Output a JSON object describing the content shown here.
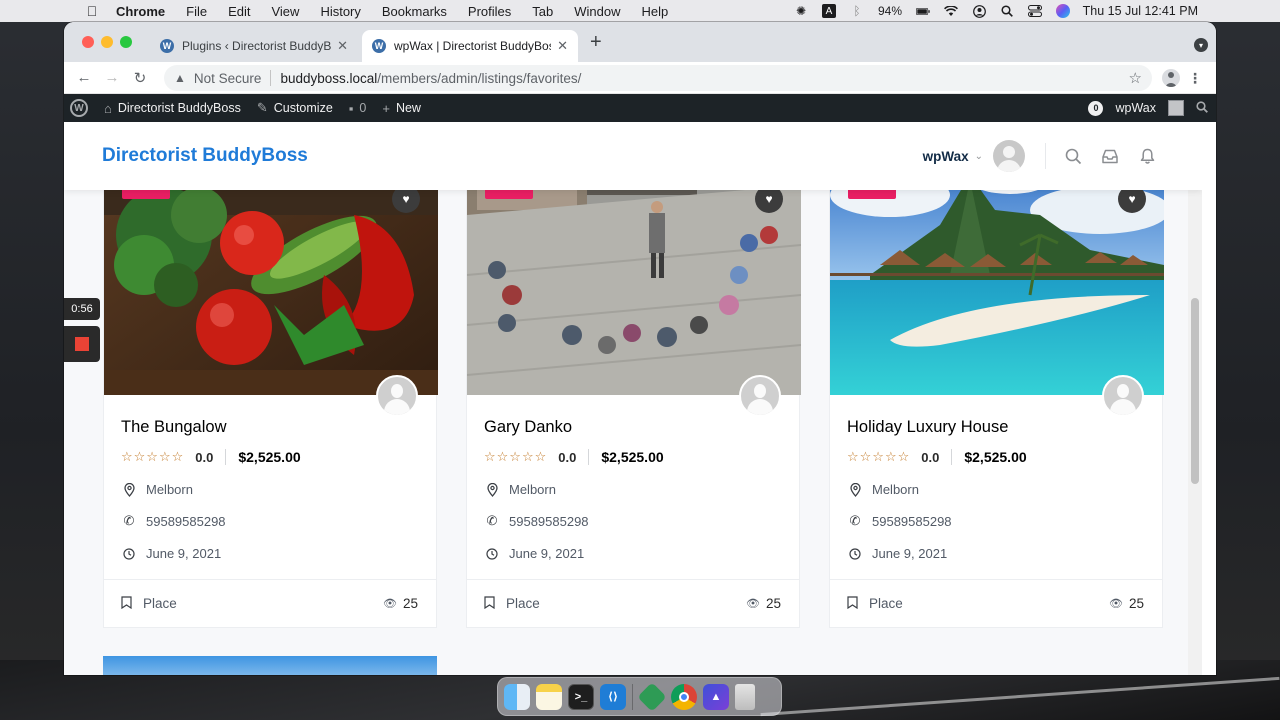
{
  "menubar": {
    "app_name": "Chrome",
    "items": [
      "File",
      "Edit",
      "View",
      "History",
      "Bookmarks",
      "Profiles",
      "Tab",
      "Window",
      "Help"
    ],
    "battery": "94%",
    "input_letter": "A",
    "clock": "Thu 15 Jul  12:41 PM"
  },
  "browser": {
    "tabs": [
      {
        "title": "Plugins ‹ Directorist BuddyBoss",
        "icon": "wordpress-icon"
      },
      {
        "title": "wpWax | Directorist BuddyBoss",
        "icon": "wordpress-icon"
      }
    ],
    "address": {
      "security": "Not Secure",
      "host": "buddyboss.local",
      "path": "/members/admin/listings/favorites/"
    }
  },
  "adminbar": {
    "site": "Directorist BuddyBoss",
    "customize": "Customize",
    "comments_count": "0",
    "new": "New",
    "notif_count": "0",
    "user": "wpWax"
  },
  "site": {
    "title": "Directorist BuddyBoss",
    "user_name": "wpWax",
    "accent": "#1f7bd8"
  },
  "recorder": {
    "timer": "0:56"
  },
  "listings": [
    {
      "title": "The Bungalow",
      "rating": "0.0",
      "price": "$2,525.00",
      "location": "Melborn",
      "phone": "59589585298",
      "date": "June 9, 2021",
      "category": "Place",
      "views": "25",
      "image": "vegetables"
    },
    {
      "title": "Gary Danko",
      "rating": "0.0",
      "price": "$2,525.00",
      "location": "Melborn",
      "phone": "59589585298",
      "date": "June 9, 2021",
      "category": "Place",
      "views": "25",
      "image": "plaza-people"
    },
    {
      "title": "Holiday Luxury House",
      "rating": "0.0",
      "price": "$2,525.00",
      "location": "Melborn",
      "phone": "59589585298",
      "date": "June 9, 2021",
      "category": "Place",
      "views": "25",
      "image": "tropical-island"
    }
  ],
  "dock": [
    "finder",
    "notes",
    "terminal",
    "vscode",
    "app",
    "chrome",
    "affinity",
    "trash"
  ]
}
